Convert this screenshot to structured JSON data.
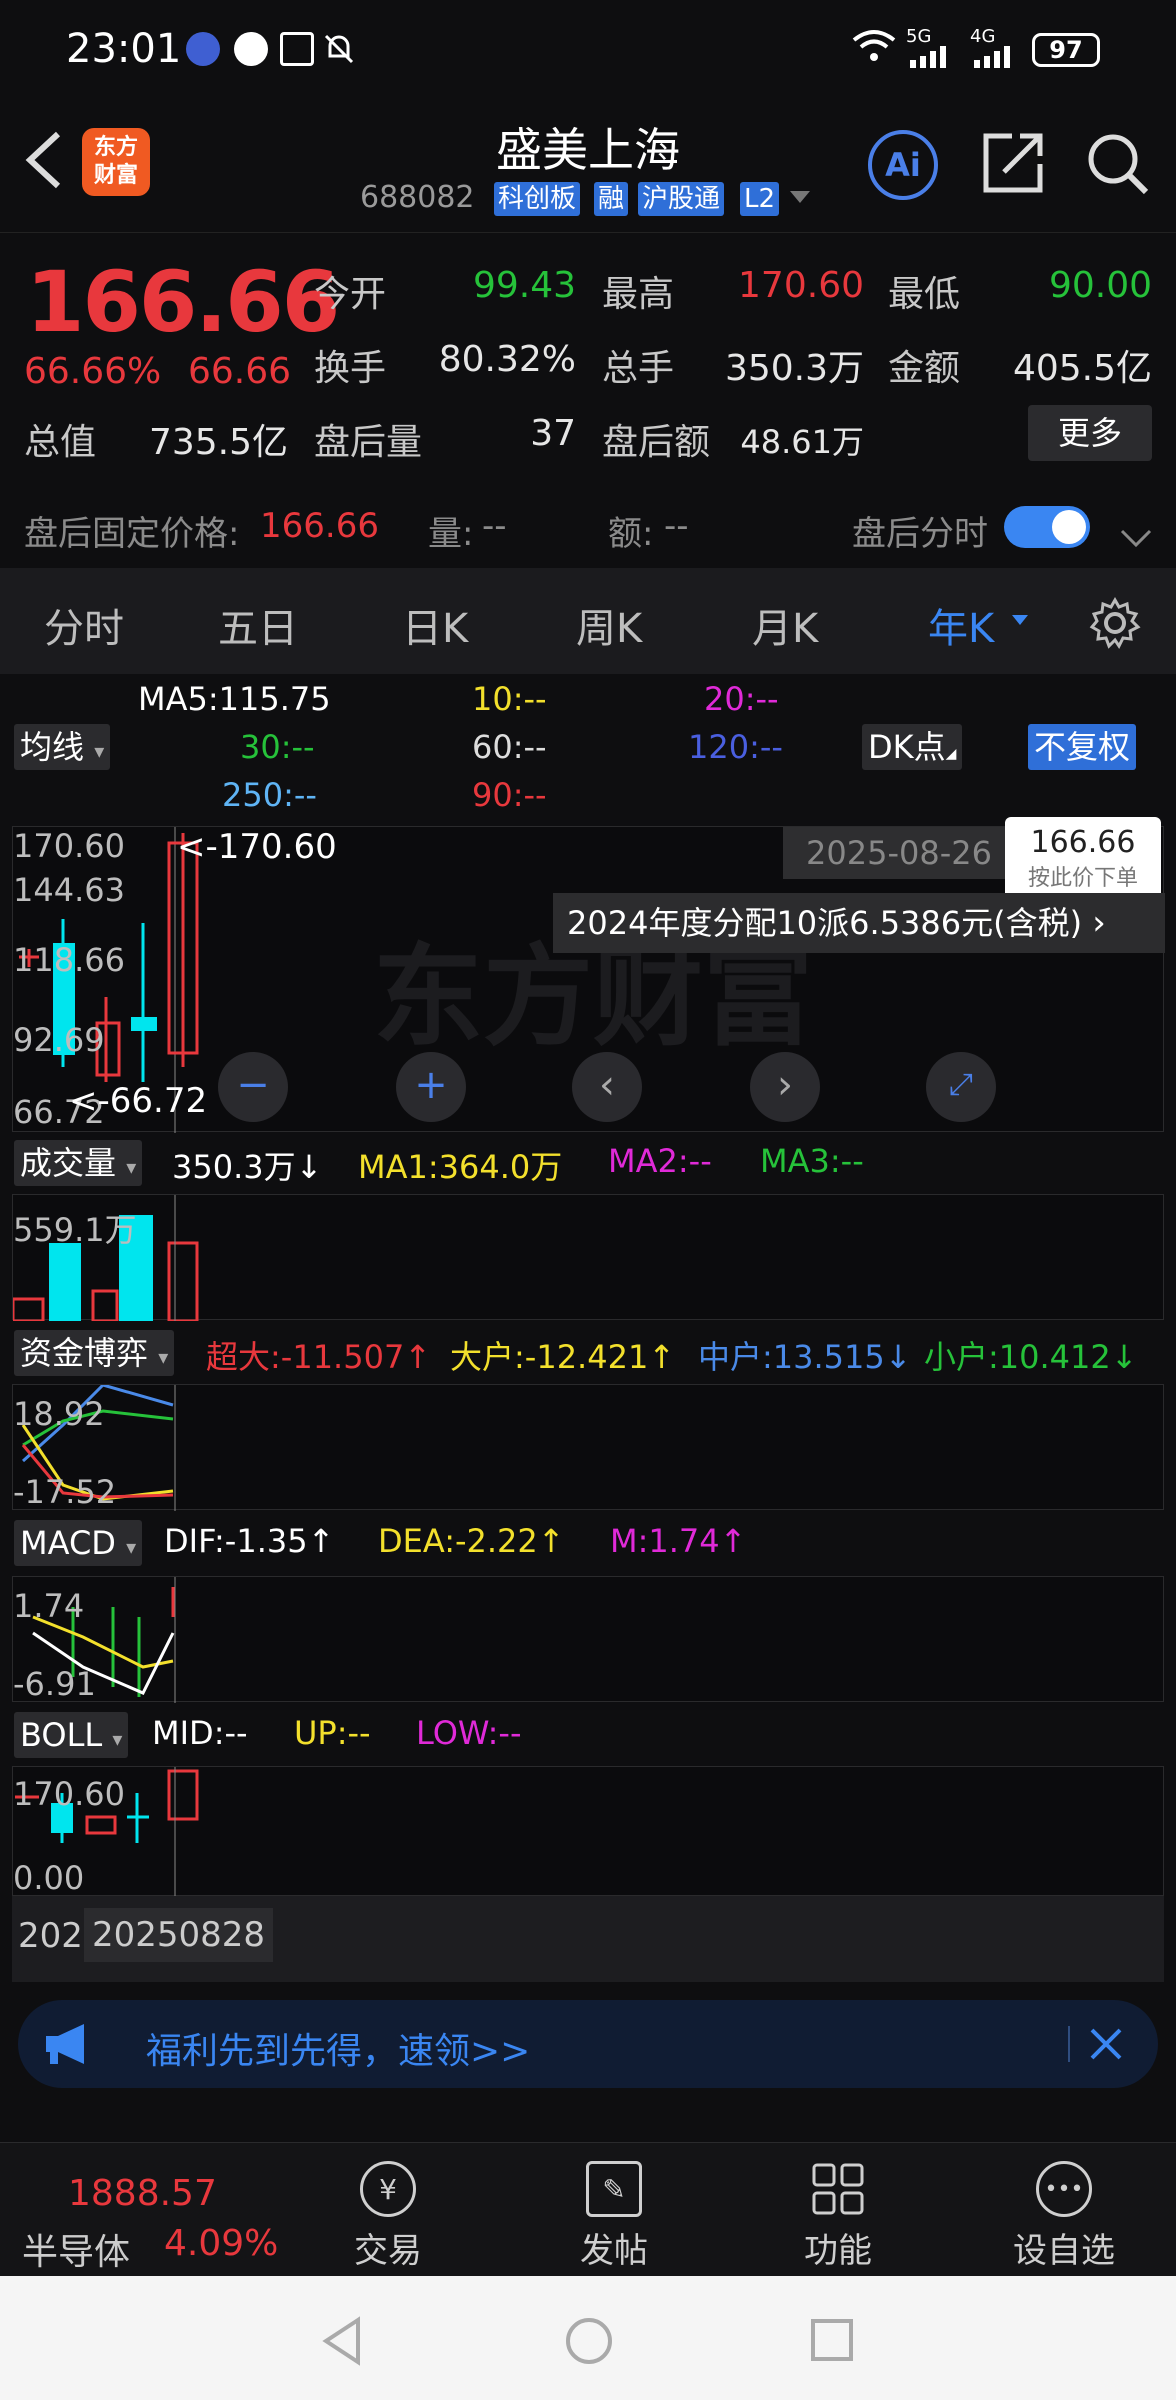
{
  "status_bar": {
    "time": "23:01",
    "battery": "97",
    "network1": "5G",
    "network2": "4G"
  },
  "header": {
    "logo_line1": "东方",
    "logo_line2": "财富",
    "name": "盛美上海",
    "code": "688082",
    "tags": [
      "科创板",
      "融",
      "沪股通",
      "L2"
    ],
    "ai_label": "Ai"
  },
  "quote": {
    "price": "166.66",
    "change_pct": "66.66%",
    "change": "66.66",
    "open_label": "今开",
    "open": "99.43",
    "high_label": "最高",
    "high": "170.60",
    "low_label": "最低",
    "low": "90.00",
    "turnover_label": "换手",
    "turnover": "80.32%",
    "volume_label": "总手",
    "volume": "350.3万",
    "amount_label": "金额",
    "amount": "405.5亿",
    "mktcap_label": "总值",
    "mktcap": "735.5亿",
    "ah_vol_label": "盘后量",
    "ah_vol": "37",
    "ah_amt_label": "盘后额",
    "ah_amt": "48.61万",
    "more": "更多"
  },
  "after_hours": {
    "fixed_label": "盘后固定价格:",
    "fixed_price": "166.66",
    "qty_label": "量:",
    "qty": "--",
    "amt_label": "额:",
    "amt": "--",
    "intraday_label": "盘后分时"
  },
  "tabs": [
    "分时",
    "五日",
    "日K",
    "周K",
    "月K",
    "年K"
  ],
  "active_tab": "年K",
  "ma": {
    "selector": "均线",
    "ma5": "MA5:115.75",
    "ma10": "10:--",
    "ma20": "20:--",
    "ma30": "30:--",
    "ma60": "60:--",
    "ma120": "120:--",
    "ma250": "250:--",
    "ma90": "90:--",
    "dk": "DK点",
    "adjust": "不复权"
  },
  "kline": {
    "ticks": [
      "170.60",
      "144.63",
      "118.66",
      "92.69",
      "66.72"
    ],
    "max_marker": "<-170.60",
    "min_marker": "<-66.72",
    "date": "2025-08-26",
    "order_price": "166.66",
    "order_label": "按此价下单",
    "dividend": "2024年度分配10派6.5386元(含税)",
    "watermark": "东方财富"
  },
  "volume": {
    "selector": "成交量",
    "value": "350.3万↓",
    "ma1": "MA1:364.0万",
    "ma2": "MA2:--",
    "ma3": "MA3:--",
    "tick": "559.1万"
  },
  "capital": {
    "selector": "资金博弈",
    "super": "超大:-11.507↑",
    "large": "大户:-12.421↑",
    "mid": "中户:13.515↓",
    "small": "小户:10.412↓",
    "ticks": [
      "18.92",
      "-17.52"
    ]
  },
  "macd": {
    "selector": "MACD",
    "dif": "DIF:-1.35↑",
    "dea": "DEA:-2.22↑",
    "m": "M:1.74↑",
    "ticks": [
      "1.74",
      "-6.91"
    ]
  },
  "boll": {
    "selector": "BOLL",
    "mid": "MID:--",
    "up": "UP:--",
    "low": "LOW:--",
    "ticks": [
      "170.60",
      "0.00"
    ]
  },
  "date_axis": {
    "left": "202",
    "cursor": "20250828"
  },
  "promo": {
    "text": "福利先到先得，速领>>"
  },
  "bottom_bar": {
    "index_value": "1888.57",
    "index_name": "半导体",
    "index_pct": "4.09%",
    "trade": "交易",
    "post": "发帖",
    "function": "功能",
    "watchlist": "设自选"
  },
  "colors": {
    "up": "#e8383d",
    "down": "#26c23a",
    "accent": "#3a86f2",
    "cyan": "#00e5ee",
    "yellow": "#f3e02c",
    "magenta": "#e02ad8"
  }
}
